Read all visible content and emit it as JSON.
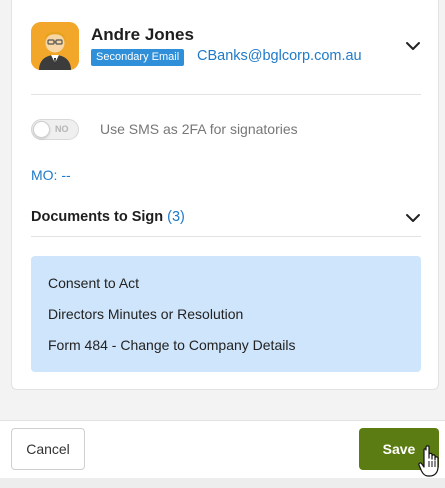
{
  "signatory": {
    "name": "Andre Jones",
    "badge": "Secondary Email",
    "email": "CBanks@bglcorp.com.au"
  },
  "sms_2fa": {
    "toggle_state": "NO",
    "label": "Use SMS as 2FA for signatories"
  },
  "mo": {
    "text": "MO: --"
  },
  "documents": {
    "title": "Documents to Sign",
    "count": "(3)",
    "items": [
      "Consent to Act",
      "Directors Minutes or Resolution",
      "Form 484 - Change to Company Details"
    ]
  },
  "footer": {
    "cancel_label": "Cancel",
    "save_label": "Save"
  },
  "colors": {
    "accent_blue": "#1f7ac8",
    "badge_blue": "#2f8fd8",
    "save_green": "#5b7c12",
    "docs_bg": "#cfe5fb",
    "avatar_bg": "#f2a72b"
  },
  "icons": [
    "avatar-person-icon",
    "chevron-down-icon",
    "pointer-hand-cursor-icon"
  ]
}
